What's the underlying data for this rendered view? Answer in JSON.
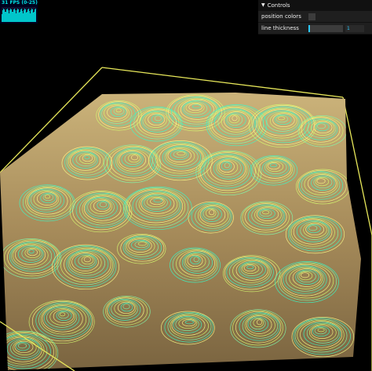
{
  "stats": {
    "fps_text": "31 FPS (0-25)",
    "graph_color": "#00ffff",
    "graph_bg": "#000022"
  },
  "controls": {
    "title": "Controls",
    "expand_icon": "chevron-down-icon",
    "position_colors": {
      "label": "position colors",
      "checked": false
    },
    "line_thickness": {
      "label": "line thickness",
      "value": "1",
      "fill_fraction": 0.05
    }
  },
  "scene": {
    "box_color": "#ffff66",
    "surface_color": "#b9a06a",
    "contour_colors": [
      "#ffff88",
      "#d8ff70",
      "#7fffb0",
      "#33ffcc"
    ]
  }
}
